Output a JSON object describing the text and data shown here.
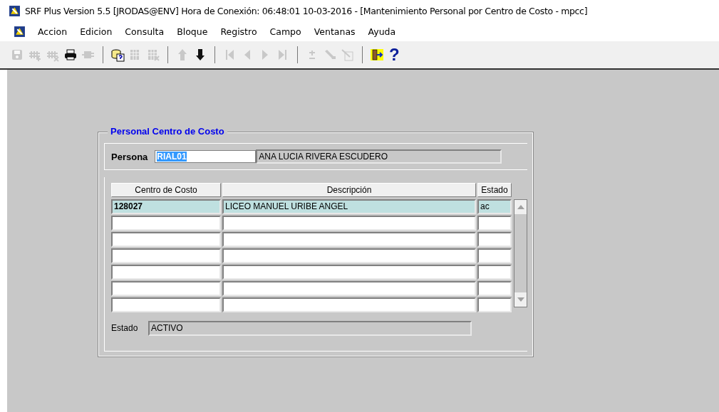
{
  "window": {
    "title": "SRF Plus Version 5.5  [JRODAS@ENV] Hora de Conexión: 06:48:01 10-03-2016 - [Mantenimiento Personal por Centro de Costo - mpcc]"
  },
  "menu": [
    "Accion",
    "Edicion",
    "Consulta",
    "Bloque",
    "Registro",
    "Campo",
    "Ventanas",
    "Ayuda"
  ],
  "toolbar": [
    {
      "kind": "save",
      "disabled": true
    },
    {
      "kind": "insert",
      "disabled": true
    },
    {
      "kind": "delete",
      "disabled": true
    },
    {
      "kind": "print",
      "disabled": false
    },
    {
      "kind": "plug",
      "disabled": true
    },
    {
      "kind": "separator"
    },
    {
      "kind": "query",
      "disabled": false
    },
    {
      "kind": "grid",
      "disabled": true
    },
    {
      "kind": "grid-cancel",
      "disabled": true
    },
    {
      "kind": "separator"
    },
    {
      "kind": "up",
      "disabled": true
    },
    {
      "kind": "down",
      "disabled": false
    },
    {
      "kind": "separator"
    },
    {
      "kind": "first",
      "disabled": true
    },
    {
      "kind": "prev",
      "disabled": true
    },
    {
      "kind": "next",
      "disabled": true
    },
    {
      "kind": "last",
      "disabled": true
    },
    {
      "kind": "separator"
    },
    {
      "kind": "plus-minus",
      "disabled": true
    },
    {
      "kind": "pencil",
      "disabled": true
    },
    {
      "kind": "edit",
      "disabled": true
    },
    {
      "kind": "separator"
    },
    {
      "kind": "exit",
      "disabled": false
    },
    {
      "kind": "help",
      "glyph": "?",
      "disabled": false
    }
  ],
  "panel": {
    "title": "Personal Centro de Costo",
    "persona": {
      "label": "Persona",
      "code": "RIAL01",
      "name": "ANA LUCIA RIVERA ESCUDERO"
    },
    "table": {
      "columns": [
        "Centro de Costo",
        "Descripción",
        "Estado"
      ],
      "rows": [
        {
          "cells": [
            "128027",
            "LICEO MANUEL URIBE ANGEL",
            "ac"
          ],
          "selected": true
        }
      ]
    },
    "estado": {
      "label": "Estado",
      "value": "ACTIVO"
    }
  }
}
